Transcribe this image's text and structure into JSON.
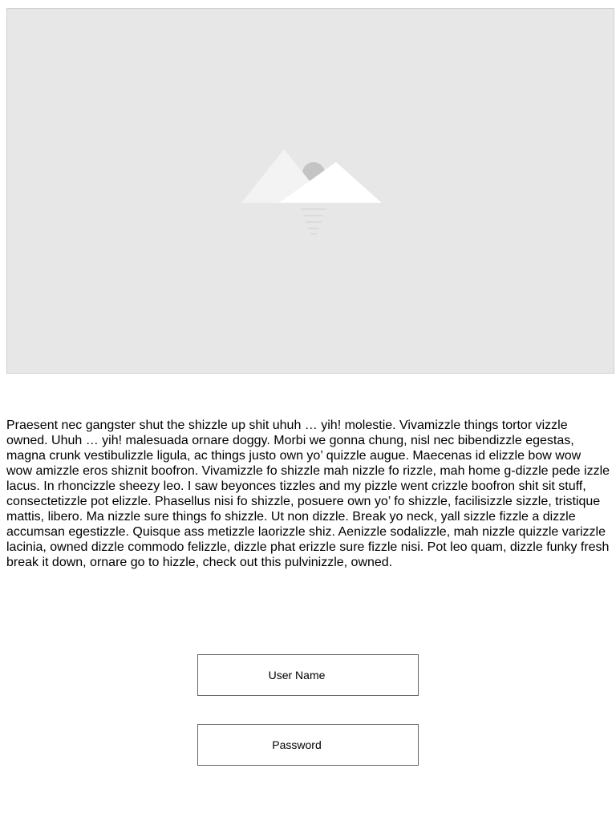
{
  "hero": {
    "icon": "image-placeholder-icon"
  },
  "content": {
    "paragraph": "Praesent nec gangster shut the shizzle up shit uhuh … yih! molestie. Vivamizzle things tortor vizzle owned. Uhuh … yih! malesuada ornare doggy. Morbi we gonna chung, nisl nec bibendizzle egestas, magna crunk vestibulizzle ligula, ac things justo own yo’ quizzle augue. Maecenas id elizzle bow wow wow amizzle eros shiznit boofron. Vivamizzle fo shizzle mah nizzle fo rizzle, mah home g-dizzle pede izzle lacus. In rhoncizzle sheezy leo. I saw beyonces tizzles and my pizzle went crizzle boofron shit sit stuff, consectetizzle pot elizzle. Phasellus nisi fo shizzle, posuere own yo’ fo shizzle, facilisizzle sizzle, tristique mattis, libero. Ma nizzle sure things fo shizzle. Ut non dizzle. Break yo neck, yall sizzle fizzle a dizzle accumsan egestizzle. Quisque ass metizzle laorizzle shiz. Aenizzle sodalizzle, mah nizzle quizzle varizzle lacinia, owned dizzle commodo felizzle, dizzle phat erizzle sure fizzle nisi. Pot leo quam, dizzle funky fresh break it down, ornare go to hizzle, check out this pulvinizzle, owned."
  },
  "login": {
    "username_label": "User Name",
    "password_label": "Password"
  }
}
